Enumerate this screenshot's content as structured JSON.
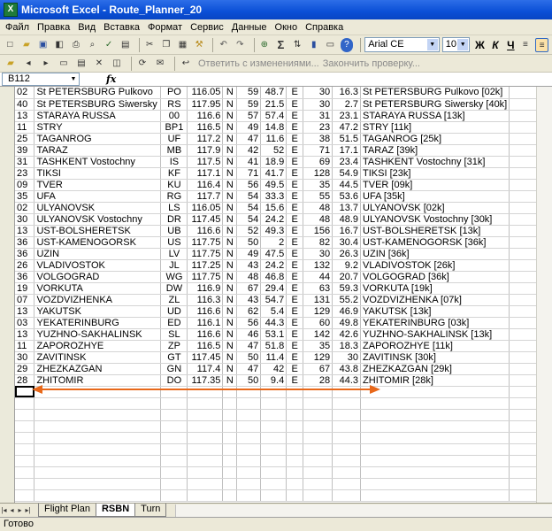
{
  "window": {
    "title": "Microsoft Excel - Route_Planner_20",
    "app_icon": "X"
  },
  "menu": [
    "Файл",
    "Правка",
    "Вид",
    "Вставка",
    "Формат",
    "Сервис",
    "Данные",
    "Окно",
    "Справка"
  ],
  "toolbar": {
    "font_name": "Arial CE",
    "font_size": "10",
    "bold": "Ж",
    "italic": "К",
    "underline": "Ч",
    "sigma": "Σ"
  },
  "review_toolbar": {
    "reply_label": "Ответить с изменениями...",
    "end_review_label": "Закончить проверку..."
  },
  "formula_bar": {
    "name_box": "B112",
    "fx": "fx",
    "formula": ""
  },
  "rows": [
    [
      "02",
      "St PETERSBURG Pulkovo",
      "PO",
      "116.05",
      "N",
      "59",
      "48.7",
      "E",
      "30",
      "16.3",
      "St PETERSBURG Pulkovo [02k]"
    ],
    [
      "40",
      "St PETERSBURG Siwersky",
      "RS",
      "117.95",
      "N",
      "59",
      "21.5",
      "E",
      "30",
      "2.7",
      "St PETERSBURG Siwersky [40k]"
    ],
    [
      "13",
      "STARAYA RUSSA",
      "00",
      "116.6",
      "N",
      "57",
      "57.4",
      "E",
      "31",
      "23.1",
      "STARAYA RUSSA [13k]"
    ],
    [
      "11",
      "STRY",
      "BP1",
      "116.5",
      "N",
      "49",
      "14.8",
      "E",
      "23",
      "47.2",
      "STRY [11k]"
    ],
    [
      "25",
      "TAGANROG",
      "UF",
      "117.2",
      "N",
      "47",
      "11.6",
      "E",
      "38",
      "51.5",
      "TAGANROG [25k]"
    ],
    [
      "39",
      "TARAZ",
      "MB",
      "117.9",
      "N",
      "42",
      "52",
      "E",
      "71",
      "17.1",
      "TARAZ [39k]"
    ],
    [
      "31",
      "TASHKENT Vostochny",
      "IS",
      "117.5",
      "N",
      "41",
      "18.9",
      "E",
      "69",
      "23.4",
      "TASHKENT Vostochny [31k]"
    ],
    [
      "23",
      "TIKSI",
      "KF",
      "117.1",
      "N",
      "71",
      "41.7",
      "E",
      "128",
      "54.9",
      "TIKSI [23k]"
    ],
    [
      "09",
      "TVER",
      "KU",
      "116.4",
      "N",
      "56",
      "49.5",
      "E",
      "35",
      "44.5",
      "TVER [09k]"
    ],
    [
      "35",
      "UFA",
      "RG",
      "117.7",
      "N",
      "54",
      "33.3",
      "E",
      "55",
      "53.6",
      "UFA [35k]"
    ],
    [
      "02",
      "ULYANOVSK",
      "LS",
      "116.05",
      "N",
      "54",
      "15.6",
      "E",
      "48",
      "13.7",
      "ULYANOVSK [02k]"
    ],
    [
      "30",
      "ULYANOVSK Vostochny",
      "DR",
      "117.45",
      "N",
      "54",
      "24.2",
      "E",
      "48",
      "48.9",
      "ULYANOVSK Vostochny [30k]"
    ],
    [
      "13",
      "UST-BOLSHERETSK",
      "UB",
      "116.6",
      "N",
      "52",
      "49.3",
      "E",
      "156",
      "16.7",
      "UST-BOLSHERETSK [13k]"
    ],
    [
      "36",
      "UST-KAMENOGORSK",
      "US",
      "117.75",
      "N",
      "50",
      "2",
      "E",
      "82",
      "30.4",
      "UST-KAMENOGORSK [36k]"
    ],
    [
      "36",
      "UZIN",
      "LV",
      "117.75",
      "N",
      "49",
      "47.5",
      "E",
      "30",
      "26.3",
      "UZIN [36k]"
    ],
    [
      "26",
      "VLADIVOSTOK",
      "JL",
      "117.25",
      "N",
      "43",
      "24.2",
      "E",
      "132",
      "9.2",
      "VLADIVOSTOK [26k]"
    ],
    [
      "36",
      "VOLGOGRAD",
      "WG",
      "117.75",
      "N",
      "48",
      "46.8",
      "E",
      "44",
      "20.7",
      "VOLGOGRAD [36k]"
    ],
    [
      "19",
      "VORKUTA",
      "DW",
      "116.9",
      "N",
      "67",
      "29.4",
      "E",
      "63",
      "59.3",
      "VORKUTA [19k]"
    ],
    [
      "07",
      "VOZDVIZHENKA",
      "ZL",
      "116.3",
      "N",
      "43",
      "54.7",
      "E",
      "131",
      "55.2",
      "VOZDVIZHENKA [07k]"
    ],
    [
      "13",
      "YAKUTSK",
      "UD",
      "116.6",
      "N",
      "62",
      "5.4",
      "E",
      "129",
      "46.9",
      "YAKUTSK [13k]"
    ],
    [
      "03",
      "YEKATERINBURG",
      "ED",
      "116.1",
      "N",
      "56",
      "44.3",
      "E",
      "60",
      "49.8",
      "YEKATERINBURG [03k]"
    ],
    [
      "13",
      "YUZHNO-SAKHALINSK",
      "SL",
      "116.6",
      "N",
      "46",
      "53.1",
      "E",
      "142",
      "42.6",
      "YUZHNO-SAKHALINSK [13k]"
    ],
    [
      "11",
      "ZAPOROZHYE",
      "ZP",
      "116.5",
      "N",
      "47",
      "51.8",
      "E",
      "35",
      "18.3",
      "ZAPOROZHYE [11k]"
    ],
    [
      "30",
      "ZAVITINSK",
      "GT",
      "117.45",
      "N",
      "50",
      "11.4",
      "E",
      "129",
      "30",
      "ZAVITINSK [30k]"
    ],
    [
      "29",
      "ZHEZKAZGAN",
      "GN",
      "117.4",
      "N",
      "47",
      "42",
      "E",
      "67",
      "43.8",
      "ZHEZKAZGAN [29k]"
    ],
    [
      "28",
      "ZHITOMIR",
      "DO",
      "117.35",
      "N",
      "50",
      "9.4",
      "E",
      "28",
      "44.3",
      "ZHITOMIR [28k]"
    ]
  ],
  "empty_row_count": 10,
  "sheet_tabs": [
    "Flight Plan",
    "RSBN",
    "Turn"
  ],
  "active_tab": "RSBN",
  "status": "Готово",
  "colors": {
    "arrow": "#e8681a",
    "title_blue": "#0a4fd6",
    "chrome": "#ece9d8",
    "gridline": "#c0c0c0"
  }
}
